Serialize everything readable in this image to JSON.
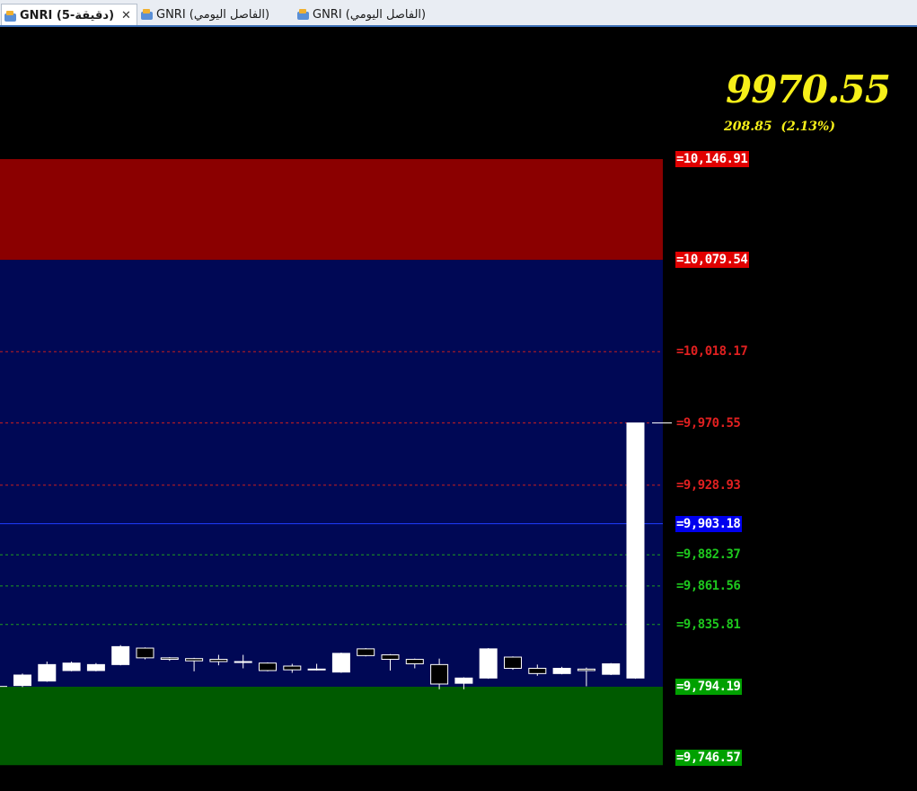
{
  "tabs": [
    {
      "label": "GNRI (دقيقة-5)",
      "active": true,
      "closable": true
    },
    {
      "label": "GNRI (الفاصل اليومي)",
      "active": false
    },
    {
      "label": "GNRI (الفاصل اليومي)",
      "active": false
    }
  ],
  "price": {
    "last": "9970.55",
    "change": "208.85  (2.13%)"
  },
  "levels": [
    {
      "label": "=10,146.91",
      "value": 10146.91,
      "color": "#ffffff",
      "bg": "#e00000"
    },
    {
      "label": "=10,079.54",
      "value": 10079.54,
      "color": "#ffffff",
      "bg": "#e00000"
    },
    {
      "label": "=10,018.17",
      "value": 10018.17,
      "color": "#e02020",
      "bg": ""
    },
    {
      "label": "=9,970.55",
      "value": 9970.55,
      "color": "#e02020",
      "bg": ""
    },
    {
      "label": "=9,928.93",
      "value": 9928.93,
      "color": "#e02020",
      "bg": ""
    },
    {
      "label": "=9,903.18",
      "value": 9903.18,
      "color": "#ffffff",
      "bg": "#0000ee"
    },
    {
      "label": "=9,882.37",
      "value": 9882.37,
      "color": "#1ec81e",
      "bg": ""
    },
    {
      "label": "=9,861.56",
      "value": 9861.56,
      "color": "#1ec81e",
      "bg": ""
    },
    {
      "label": "=9,835.81",
      "value": 9835.81,
      "color": "#1ec81e",
      "bg": ""
    },
    {
      "label": "=9,794.19",
      "value": 9794.19,
      "color": "#ffffff",
      "bg": "#00a000"
    },
    {
      "label": "=9,746.57",
      "value": 9746.57,
      "color": "#ffffff",
      "bg": "#00a000"
    }
  ],
  "zones": {
    "resistance": "#8b0000",
    "middle": "#000855",
    "support": "#005a00"
  },
  "chart_data": {
    "type": "candlestick",
    "title": "",
    "xlabel": "",
    "ylabel": "",
    "ylim": [
      9730,
      10170
    ],
    "current_price": 9970.55,
    "pivot": 9903.18,
    "resistance_zone": [
      10079.54,
      10146.91
    ],
    "support_zone": [
      9746.57,
      9794.19
    ],
    "dashed_levels_red": [
      10018.17,
      9970.55,
      9928.93
    ],
    "dashed_levels_green": [
      9882.37,
      9861.56,
      9835.81
    ],
    "candles": [
      {
        "o": 9795.0,
        "c": 9802.0,
        "h": 9803.0,
        "l": 9794.0
      },
      {
        "o": 9798.0,
        "c": 9809.0,
        "h": 9811.0,
        "l": 9797.5
      },
      {
        "o": 9805.0,
        "c": 9810.0,
        "h": 9811.0,
        "l": 9804.5
      },
      {
        "o": 9805.0,
        "c": 9809.0,
        "h": 9810.0,
        "l": 9804.5
      },
      {
        "o": 9809.0,
        "c": 9821.0,
        "h": 9822.0,
        "l": 9808.5
      },
      {
        "o": 9820.0,
        "c": 9813.5,
        "h": 9820.5,
        "l": 9812.5
      },
      {
        "o": 9813.5,
        "c": 9812.5,
        "h": 9814.0,
        "l": 9811.5
      },
      {
        "o": 9813.0,
        "c": 9811.5,
        "h": 9813.5,
        "l": 9804.5
      },
      {
        "o": 9812.5,
        "c": 9811.0,
        "h": 9815.5,
        "l": 9808.5
      },
      {
        "o": 9811.0,
        "c": 9811.0,
        "h": 9815.5,
        "l": 9806.5
      },
      {
        "o": 9810.0,
        "c": 9805.0,
        "h": 9810.5,
        "l": 9804.5
      },
      {
        "o": 9808.0,
        "c": 9805.5,
        "h": 9809.5,
        "l": 9803.5
      },
      {
        "o": 9805.5,
        "c": 9806.0,
        "h": 9809.5,
        "l": 9805.0
      },
      {
        "o": 9804.0,
        "c": 9816.5,
        "h": 9817.0,
        "l": 9803.5
      },
      {
        "o": 9819.5,
        "c": 9815.0,
        "h": 9820.0,
        "l": 9814.5
      },
      {
        "o": 9815.5,
        "c": 9812.5,
        "h": 9816.0,
        "l": 9805.0
      },
      {
        "o": 9812.5,
        "c": 9809.5,
        "h": 9813.0,
        "l": 9806.5
      },
      {
        "o": 9809.0,
        "c": 9796.0,
        "h": 9813.0,
        "l": 9792.5
      },
      {
        "o": 9796.5,
        "c": 9800.0,
        "h": 9800.5,
        "l": 9792.5
      },
      {
        "o": 9800.0,
        "c": 9819.5,
        "h": 9820.0,
        "l": 9799.5
      },
      {
        "o": 9814.0,
        "c": 9806.5,
        "h": 9814.5,
        "l": 9805.5
      },
      {
        "o": 9806.5,
        "c": 9803.0,
        "h": 9809.0,
        "l": 9801.5
      },
      {
        "o": 9803.0,
        "c": 9806.5,
        "h": 9807.5,
        "l": 9802.5
      },
      {
        "o": 9806.0,
        "c": 9805.0,
        "h": 9807.0,
        "l": 9794.5
      },
      {
        "o": 9802.5,
        "c": 9809.5,
        "h": 9810.0,
        "l": 9802.0
      },
      {
        "o": 9800.0,
        "c": 9970.55,
        "h": 9970.55,
        "l": 9799.5
      }
    ]
  }
}
